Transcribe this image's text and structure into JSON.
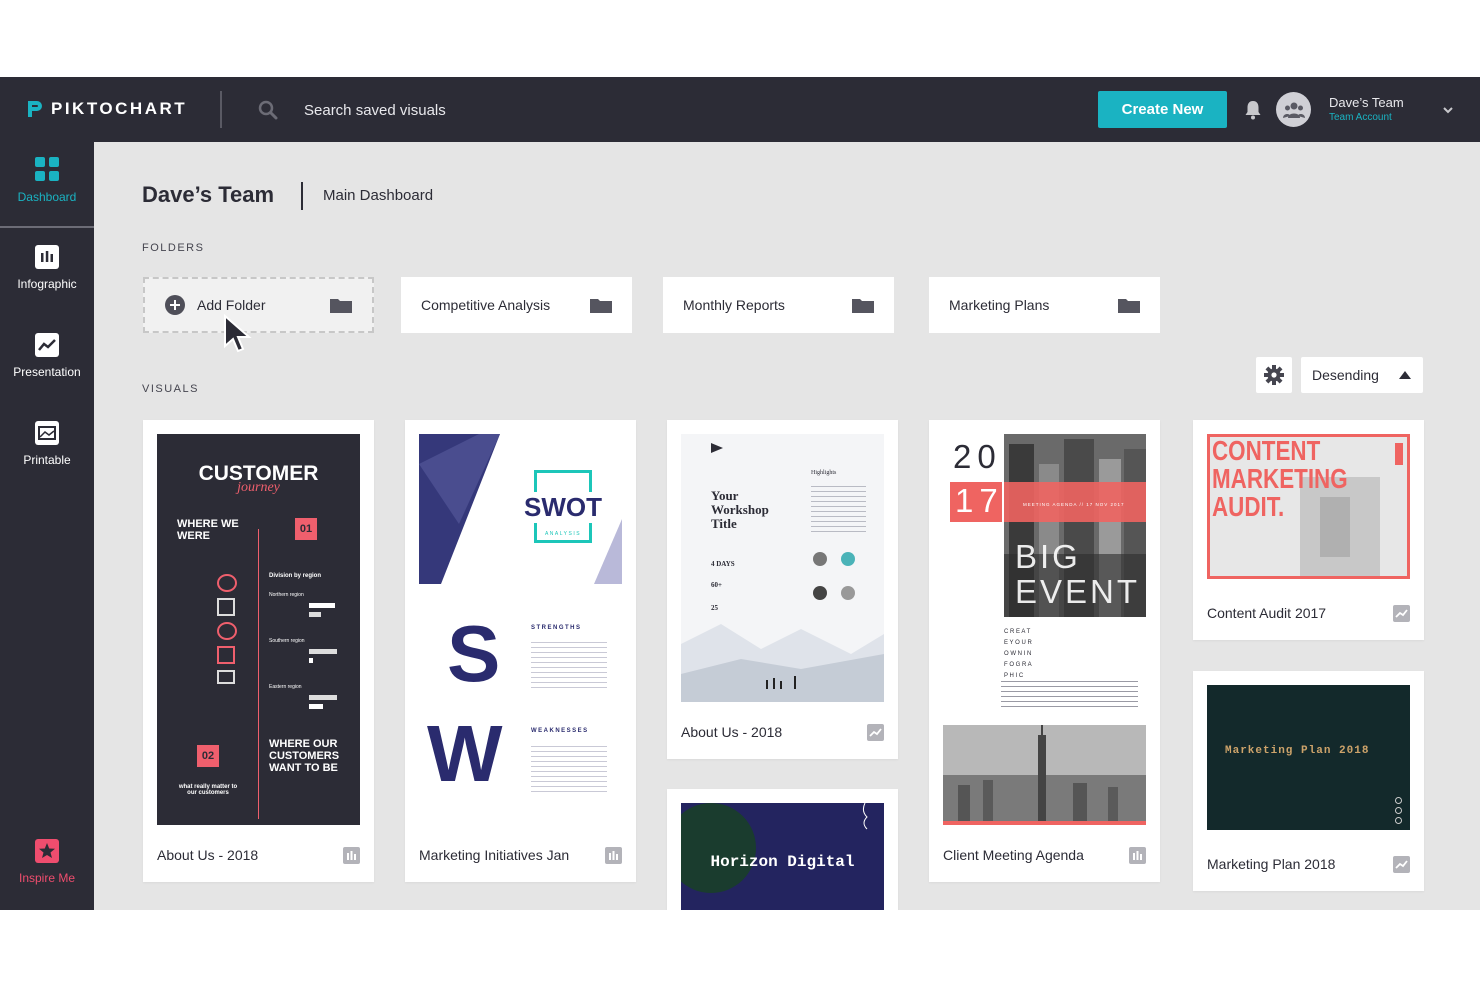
{
  "app": {
    "logo": "PIKTOCHART",
    "search_placeholder": "Search saved visuals",
    "create_label": "Create New",
    "account_name": "Dave’s Team",
    "account_type": "Team Account"
  },
  "sidebar": {
    "items": [
      {
        "label": "Dashboard",
        "icon": "dashboard-icon",
        "active": true
      },
      {
        "label": "Infographic",
        "icon": "infographic-icon"
      },
      {
        "label": "Presentation",
        "icon": "presentation-icon"
      },
      {
        "label": "Printable",
        "icon": "printable-icon"
      }
    ],
    "inspire_label": "Inspire Me"
  },
  "page": {
    "team": "Dave’s Team",
    "dashboard": "Main Dashboard",
    "folders_label": "FOLDERS",
    "visuals_label": "VISUALS",
    "sort_label": "Desending"
  },
  "folders": [
    {
      "name": "Add Folder"
    },
    {
      "name": "Competitive Analysis"
    },
    {
      "name": "Monthly Reports"
    },
    {
      "name": "Marketing Plans"
    }
  ],
  "visuals": [
    {
      "title": "About Us - 2018",
      "type_icon": "infographic-icon",
      "thumb": {
        "title": "CUSTOMER",
        "script": "journey",
        "where_we": "WHERE WE WERE",
        "num1": "01",
        "num2": "02",
        "where_customers": "WHERE OUR CUSTOMERS WANT TO BE",
        "footer": "what really matter to our customers",
        "division": "Division by region",
        "northern": "Northern region",
        "southern": "Southern region",
        "eastern": "Eastern region"
      }
    },
    {
      "title": "Marketing Initiatives Jan",
      "type_icon": "infographic-icon",
      "thumb": {
        "swot": "SWOT",
        "analysis": "ANALYSIS",
        "letter1": "S",
        "letter2": "W",
        "strengths": "STRENGTHS",
        "weaknesses": "WEAKNESSES"
      }
    },
    {
      "title": "About Us - 2018",
      "type_icon": "presentation-icon",
      "thumb": {
        "title": "Your Workshop Title",
        "days": "4 DAYS",
        "plus": "60+",
        "count": "25",
        "highlights": "Highlights"
      }
    },
    {
      "title": "Horizon Digital",
      "type_icon": "",
      "thumb": {
        "title": "Horizon Digital"
      }
    },
    {
      "title": "Client Meeting Agenda",
      "type_icon": "infographic-icon",
      "thumb": {
        "year_top": "20",
        "year_bottom": "17",
        "meeting": "MEETING AGENDA // 17 NOV 2017",
        "big": "BIG",
        "event": "EVENT",
        "create": "C R E A T E   Y O U R   O W N   I N F O G R A P H I C"
      }
    },
    {
      "title": "Content Audit 2017",
      "type_icon": "presentation-icon",
      "thumb": {
        "title": "CONTENT MARKETING AUDIT."
      }
    },
    {
      "title": "Marketing Plan 2018",
      "type_icon": "presentation-icon",
      "thumb": {
        "title": "Marketing Plan 2018"
      }
    }
  ],
  "colors": {
    "topbar": "#2c2c36",
    "accent": "#1ab3c2",
    "inspire": "#ef4d6e",
    "background": "#e5e5e5"
  }
}
